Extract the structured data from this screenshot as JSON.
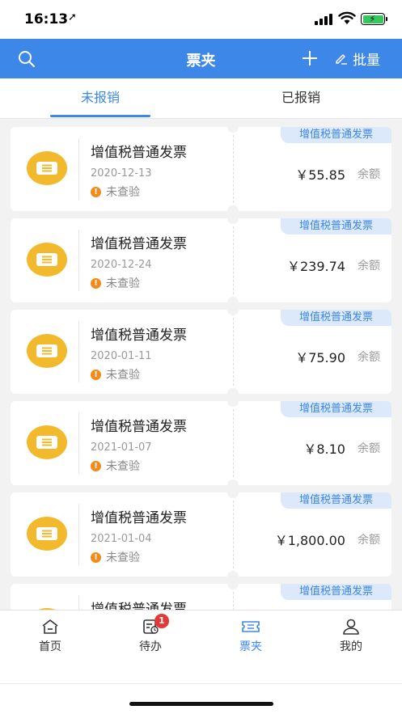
{
  "status_bar": {
    "time": "16:13",
    "location_glyph": "➚",
    "battery_bolt": "⚡"
  },
  "nav": {
    "title": "票夹",
    "batch_label": "批量",
    "icons": [
      "search-icon",
      "add-icon",
      "edit-icon"
    ]
  },
  "tabs": [
    {
      "label": "未报销",
      "active": true
    },
    {
      "label": "已报销",
      "active": false
    }
  ],
  "invoices": [
    {
      "type": "增值税普通发票",
      "title": "增值税普通发票",
      "date": "2020-12-13",
      "status": "未查验",
      "amount": "￥55.85",
      "balance_label": "余额"
    },
    {
      "type": "增值税普通发票",
      "title": "增值税普通发票",
      "date": "2020-12-24",
      "status": "未查验",
      "amount": "￥239.74",
      "balance_label": "余额"
    },
    {
      "type": "增值税普通发票",
      "title": "增值税普通发票",
      "date": "2020-01-11",
      "status": "未查验",
      "amount": "￥75.90",
      "balance_label": "余额"
    },
    {
      "type": "增值税普通发票",
      "title": "增值税普通发票",
      "date": "2021-01-07",
      "status": "未查验",
      "amount": "￥8.10",
      "balance_label": "余额"
    },
    {
      "type": "增值税普通发票",
      "title": "增值税普通发票",
      "date": "2021-01-04",
      "status": "未查验",
      "amount": "￥1,800.00",
      "balance_label": "余额"
    },
    {
      "type": "增值税普通发票",
      "title": "增值税普通发票",
      "date": "",
      "status": "",
      "amount": "",
      "balance_label": ""
    }
  ],
  "tabbar": [
    {
      "label": "首页",
      "icon": "home-icon",
      "active": false
    },
    {
      "label": "待办",
      "icon": "todo-icon",
      "active": false,
      "badge": "1"
    },
    {
      "label": "票夹",
      "icon": "ticket-folder-icon",
      "active": true
    },
    {
      "label": "我的",
      "icon": "profile-icon",
      "active": false
    }
  ],
  "colors": {
    "primary": "#3d87e8",
    "ticket_yellow": "#f2b92d",
    "warning": "#f28a1c",
    "badge_red": "#e53935"
  }
}
